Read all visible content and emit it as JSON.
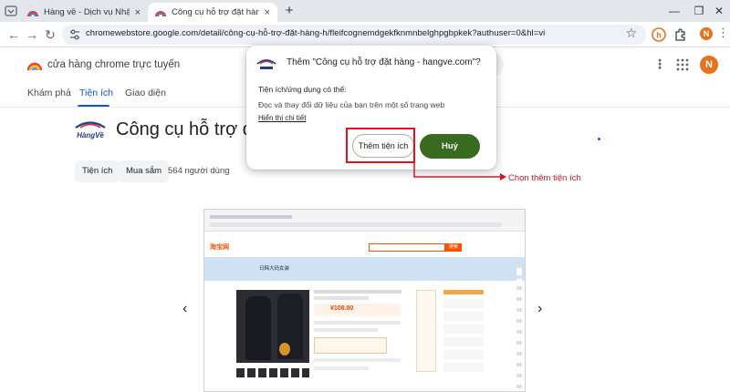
{
  "browser": {
    "tabs": [
      {
        "title": "Hàng về - Dịch vụ Nhập hàng tì",
        "close": "×"
      },
      {
        "title": "Công cụ hỗ trợ đặt hàng - hang",
        "close": "×"
      }
    ],
    "new_tab": "+",
    "window_controls": {
      "minimize": "—",
      "maximize": "❐",
      "close": "✕"
    },
    "url": "chromewebstore.google.com/detail/công-cụ-hỗ-trợ-đặt-hàng-h/fleifcognemdgekfknmnbelghpgbpkek?authuser=0&hl=vi",
    "profile_initial": "N",
    "menu": "⋮",
    "nav": {
      "back": "←",
      "forward": "→",
      "reload": "↻"
    },
    "bookmark": "☆"
  },
  "store": {
    "name": "cửa hàng chrome trực tuyến",
    "avatar_initial": "N",
    "more": "⋮",
    "nav_tabs": [
      {
        "label": "Khám phá"
      },
      {
        "label": "Tiện ích"
      },
      {
        "label": "Giao diện"
      }
    ]
  },
  "extension": {
    "title": "Công cụ hỗ trợ đ",
    "logo_text": "HàngVề",
    "chips": [
      "Tiện ích",
      "Mua sắm"
    ],
    "users": "564 người dùng"
  },
  "preview": {
    "logo": "淘宝网",
    "banner_text": "日韩大码女装",
    "price": "¥108.00",
    "search_btn": "搜索"
  },
  "carousel": {
    "prev": "‹",
    "next": "›"
  },
  "dialog": {
    "title": "Thêm \"Công cụ hỗ trợ đặt hàng - hangve.com\"?",
    "subtitle": "Tiện ích/ứng dụng có thể:",
    "permission": "Đọc và thay đổi dữ liệu của bạn trên một số trang web",
    "details_link": "Hiển thị chi tiết",
    "add_button": "Thêm tiện ích",
    "cancel_button": "Huỷ"
  },
  "annotation": "Chọn thêm tiện ích",
  "colors": {
    "accent": "#0b57d0",
    "cancel_green": "#386a20",
    "annotation_red": "#e0141e",
    "tabstrip": "#e3e7ec"
  }
}
